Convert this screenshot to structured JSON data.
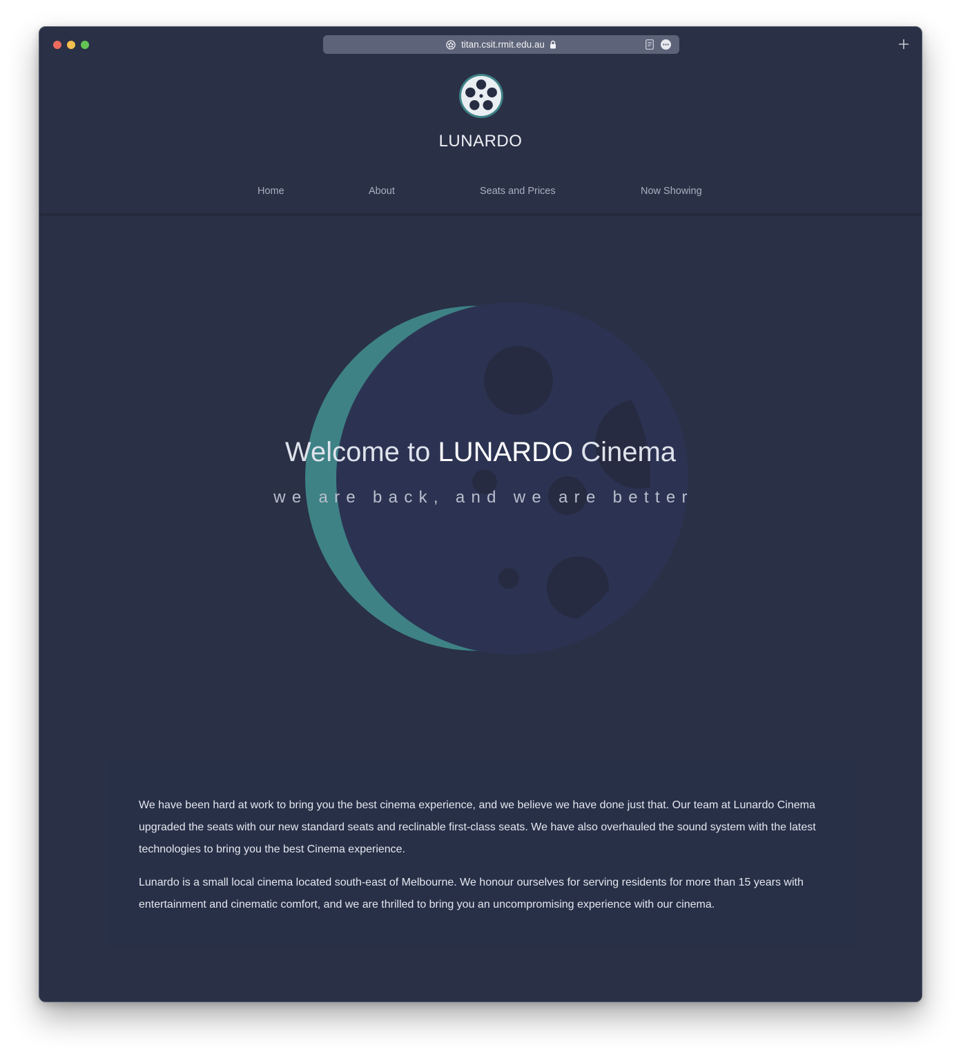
{
  "browser": {
    "url": "titan.csit.rmit.edu.au",
    "icons": [
      "site-icon",
      "lock-icon",
      "reader-icon",
      "more-icon",
      "new-tab-icon"
    ]
  },
  "header": {
    "logo_icon": "film-reel-icon",
    "brand": "LUNARDO"
  },
  "nav": {
    "items": [
      {
        "label": "Home"
      },
      {
        "label": "About"
      },
      {
        "label": "Seats and Prices"
      },
      {
        "label": "Now Showing"
      }
    ]
  },
  "hero": {
    "title_prefix": "Welcome to ",
    "title_strong": "LUNARDO",
    "title_suffix": " Cinema",
    "subtitle": "we are back, and we are better",
    "background_icon": "crescent-moon-icon"
  },
  "about": {
    "paragraphs": [
      "We have been hard at work to bring you the best cinema experience, and we believe we have done just that. Our team at Lunardo Cinema upgraded the seats with our new standard seats and reclinable first-class seats. We have also overhauled the sound system with the latest technologies to bring you the best Cinema experience.",
      "Lunardo is a small local cinema located south-east of Melbourne. We honour ourselves for serving residents for more than 15 years with entertainment and cinematic comfort, and we are thrilled to bring you an uncompromising experience with our cinema."
    ]
  },
  "colors": {
    "page_background": "#2a3046",
    "accent_teal": "#3e8286",
    "text_light": "#eef0f5",
    "nav_text": "#aab0c0"
  }
}
